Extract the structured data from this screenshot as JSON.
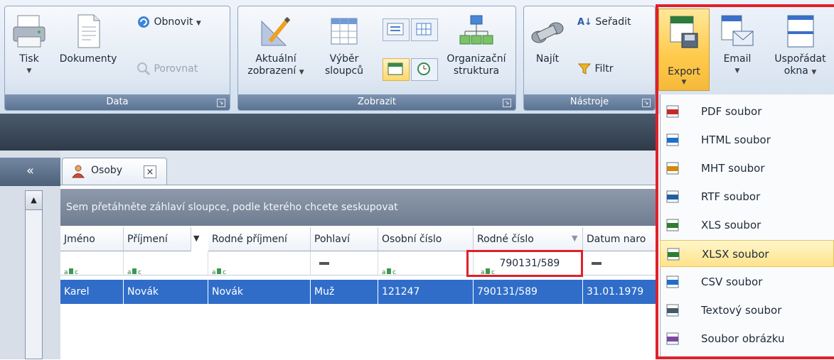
{
  "ribbon": {
    "groups": {
      "data": "Data",
      "zobrazit": "Zobrazit",
      "nastroje": "Nástroje"
    },
    "buttons": {
      "tisk": "Tisk",
      "dokumenty": "Dokumenty",
      "obnovit": "Obnovit",
      "porovnat": "Porovnat",
      "aktualni_1": "Aktuální",
      "aktualni_2": "zobrazení",
      "vyber_1": "Výběr",
      "vyber_2": "sloupců",
      "org_1": "Organizační",
      "org_2": "struktura",
      "najit": "Najít",
      "seradit": "Seřadit",
      "filtr": "Filtr",
      "export": "Export",
      "email": "Email",
      "usporadat_1": "Uspořádat",
      "usporadat_2": "okna"
    }
  },
  "sidebar": {
    "collapse_label": "«"
  },
  "tab": {
    "label": "Osoby",
    "close": "×"
  },
  "grid": {
    "group_hint": "Sem přetáhněte záhlaví sloupce, podle kterého chcete seskupovat",
    "columns": [
      "Jméno",
      "Příjmení",
      "Rodné příjmení",
      "Pohlaví",
      "Osobní číslo",
      "Rodné číslo",
      "Datum naro"
    ],
    "filter_value_rodne_cislo": "790131/589",
    "rows": [
      [
        "Karel",
        "Novák",
        "Novák",
        "Muž",
        "121247",
        "790131/589",
        "31.01.1979"
      ]
    ]
  },
  "export_menu": {
    "items": [
      "PDF soubor",
      "HTML soubor",
      "MHT soubor",
      "RTF soubor",
      "XLS soubor",
      "XLSX soubor",
      "CSV soubor",
      "Textový soubor",
      "Soubor obrázku"
    ],
    "highlighted_index": 5,
    "icon_tags": [
      "PDF",
      "HTML",
      "MHT",
      "RTF",
      "XLS",
      "XLSX",
      "CSV",
      "TXT",
      "IMG"
    ]
  },
  "colors": {
    "highlight": "#e0202a",
    "selected_row": "#2f6dc9",
    "ribbon_group_title": "#6a819f"
  }
}
